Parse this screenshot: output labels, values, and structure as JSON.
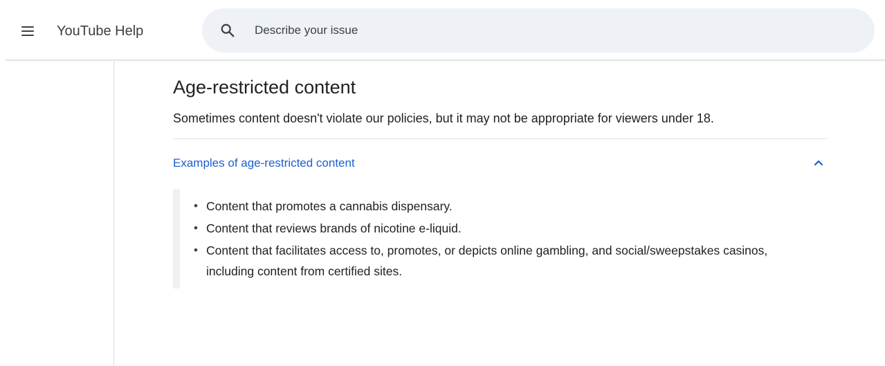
{
  "header": {
    "app_title": "YouTube Help",
    "menu_icon": "menu-icon",
    "search": {
      "placeholder": "Describe your issue",
      "value": "",
      "icon": "search-icon"
    }
  },
  "article": {
    "title": "Age-restricted content",
    "intro": "Sometimes content doesn't violate our policies, but it may not be appropriate for viewers under 18.",
    "accordion": {
      "title": "Examples of age-restricted content",
      "expanded": true,
      "toggle_icon": "chevron-up-icon",
      "items": [
        "Content that promotes a cannabis dispensary.",
        "Content that reviews brands of nicotine e-liquid.",
        "Content that facilitates access to, promotes, or depicts online gambling, and social/sweepstakes casinos, including content from certified sites."
      ]
    }
  },
  "colors": {
    "link": "#1a5fd0",
    "search_background": "#eef2f7",
    "text": "#202124"
  }
}
